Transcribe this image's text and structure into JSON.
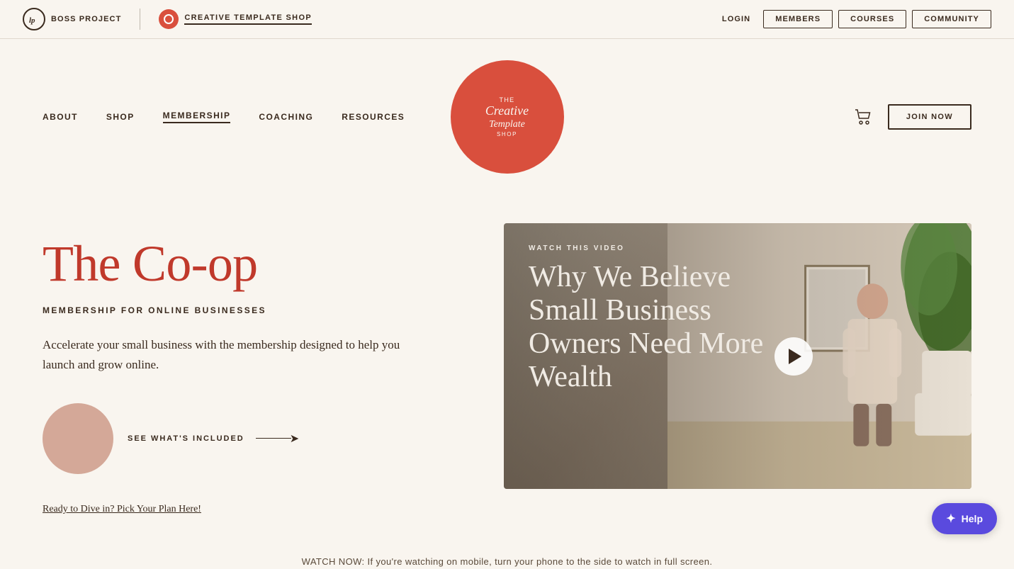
{
  "topBar": {
    "bossProject": {
      "iconText": "bp",
      "label": "BOSS PROJECT"
    },
    "creativeTemplateShop": {
      "label": "CREATIVE TEMPLATE SHOP"
    },
    "navLinks": [
      {
        "id": "login",
        "label": "LOGIN"
      },
      {
        "id": "members",
        "label": "MEMBERS"
      },
      {
        "id": "courses",
        "label": "COURSES"
      },
      {
        "id": "community",
        "label": "COMMUNITY"
      }
    ]
  },
  "mainNav": {
    "leftLinks": [
      {
        "id": "about",
        "label": "ABOUT",
        "active": false
      },
      {
        "id": "shop",
        "label": "SHOP",
        "active": false
      },
      {
        "id": "membership",
        "label": "MEMBERSHIP",
        "active": true
      },
      {
        "id": "coaching",
        "label": "COACHING",
        "active": false
      },
      {
        "id": "resources",
        "label": "RESOURCES",
        "active": false
      }
    ],
    "logo": {
      "the": "THE",
      "creative": "Creative",
      "template": "Template",
      "shop": "Shop"
    },
    "joinButton": "JOIN NOW"
  },
  "hero": {
    "title": "The Co-op",
    "subtitle": "MEMBERSHIP FOR ONLINE BUSINESSES",
    "description": "Accelerate your small business with the membership designed to help you launch and grow online.",
    "seeIncluded": "SEE WHAT'S INCLUDED",
    "bottomLink": "Ready to Dive in? Pick Your Plan Here!"
  },
  "video": {
    "watchLabel": "WATCH THIS VIDEO",
    "title": "Why We Believe Small Business Owners Need More Wealth",
    "watchNow": "WATCH NOW: If you're watching on mobile, turn your phone to the side to watch in full screen."
  },
  "help": {
    "label": "Help"
  }
}
